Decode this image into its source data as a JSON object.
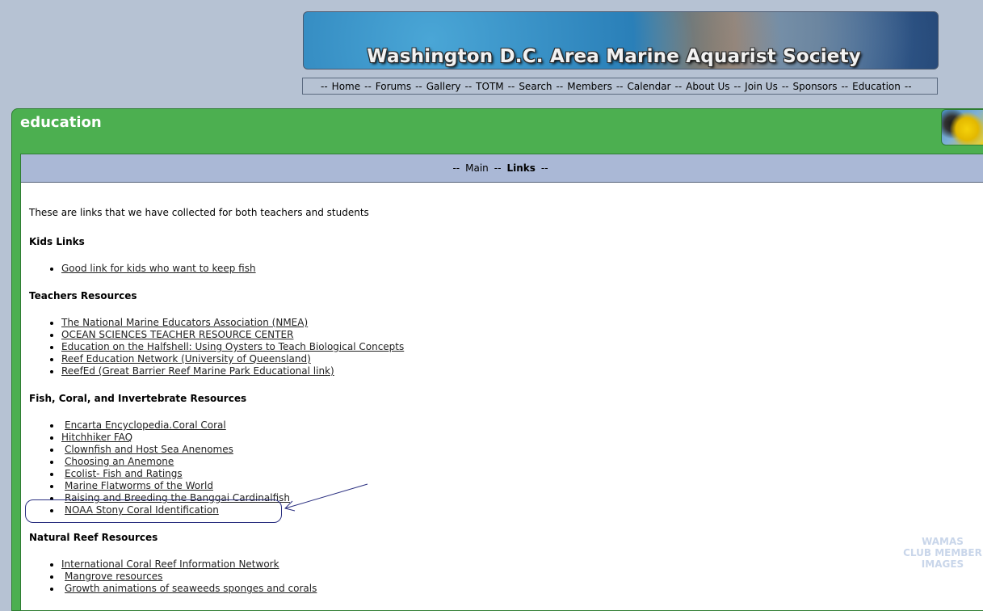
{
  "banner": {
    "title": "Washington D.C. Area Marine Aquarist Society"
  },
  "topnav": [
    {
      "label": "Home"
    },
    {
      "label": "Forums"
    },
    {
      "label": "Gallery"
    },
    {
      "label": "TOTM"
    },
    {
      "label": "Search"
    },
    {
      "label": "Members"
    },
    {
      "label": "Calendar"
    },
    {
      "label": "About Us"
    },
    {
      "label": "Join Us"
    },
    {
      "label": "Sponsors"
    },
    {
      "label": "Education"
    }
  ],
  "nav_separator": "--",
  "page": {
    "title": "education"
  },
  "subnav": [
    {
      "label": "Main"
    },
    {
      "label": "Links"
    }
  ],
  "intro": "These are links that we have collected for both teachers and students",
  "sections": {
    "kids": {
      "heading": "Kids Links",
      "links": [
        "Good link for kids who want to keep fish"
      ]
    },
    "teachers": {
      "heading": "Teachers Resources",
      "links": [
        "The National Marine Educators Association (NMEA)",
        "OCEAN SCIENCES TEACHER RESOURCE CENTER",
        "Education on the Halfshell: Using Oysters to Teach Biological Concepts",
        "Reef Education Network (University of Queensland)",
        "ReefEd (Great Barrier Reef Marine Park Educational link)"
      ]
    },
    "fish": {
      "heading": "Fish, Coral, and Invertebrate Resources",
      "links": [
        "Encarta Encyclopedia.Coral Coral",
        "Hitchhiker FAQ",
        "Clownfish and Host Sea Anenomes",
        "Choosing an Anemone",
        "Ecolist- Fish and Ratings",
        "Marine Flatworms of the World",
        "Raising and Breeding the Banggai Cardinalfish",
        "NOAA Stony Coral Identification"
      ]
    },
    "reef": {
      "heading": "Natural Reef Resources",
      "links": [
        "International Coral Reef Information Network",
        "Mangrove resources",
        "Growth animations of seaweeds sponges and corals"
      ]
    }
  },
  "watermark": [
    "WAMAS",
    "CLUB MEMBER",
    "IMAGES"
  ],
  "colors": {
    "background": "#b6c2d3",
    "panel_green": "#4caf50",
    "subnav_bg": "#aab8d6",
    "annotation": "#2a2f80"
  }
}
